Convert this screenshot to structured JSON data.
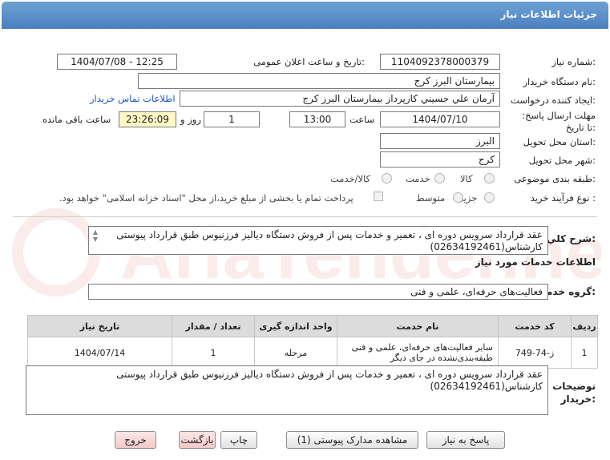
{
  "header": {
    "title": "جزئیات اطلاعات نیاز"
  },
  "form": {
    "need_number_label": "شماره نیاز:",
    "need_number": "1104092378000379",
    "announce_label": "تاریخ و ساعت اعلان عمومی:",
    "announce_value": "1404/07/08 - 12:25",
    "buyer_org_label": "نام دستگاه خریدار:",
    "buyer_org": "بیمارستان البرز کرج",
    "requester_label": "ایجاد کننده درخواست:",
    "requester": "آرمان علي حسيني كارپرداز بیمارستان البرز کرج",
    "contact_link": "اطلاعات تماس خریدار",
    "deadline_label": "مهلت ارسال پاسخ: تا تاریخ:",
    "deadline_date": "1404/07/10",
    "time_label": "ساعت",
    "deadline_time": "13:00",
    "days_value": "1",
    "days_label": "روز و",
    "remaining_time": "23:26:09",
    "remaining_label": "ساعت باقی مانده",
    "province_label": "استان محل تحویل:",
    "province": "البرز",
    "city_label": "شهر محل تحویل:",
    "city": "کرج",
    "category_label": "طبقه بندی موضوعی:",
    "category_options": [
      "کالا",
      "خدمت",
      "کالا/خدمت"
    ],
    "process_label": "نوع فرآیند خرید :",
    "process_options": [
      "جزیی",
      "متوسط"
    ],
    "payment_note": "پرداخت تمام یا بخشی از مبلغ خرید،از محل \"اسناد خزانه اسلامی\" خواهد بود."
  },
  "summary": {
    "label": "شرح کلي نياز:",
    "text": "عقد قرارداد سرویس دوره ای ، تعمیر و خدمات پس از فروش دستگاه دیالیز فرزنیوس طبق قرارداد پیوستی کارشناس(02634192461)"
  },
  "services_section": {
    "title": "اطلاعات خدمات مورد نیاز"
  },
  "service_group": {
    "label": "گروه خدمت:",
    "value": "فعالیت‌های حرفه‌ای، علمی و فنی"
  },
  "table": {
    "headers": [
      "ردیف",
      "کد خدمت",
      "نام خدمت",
      "واحد اندازه گیری",
      "تعداد / مقدار",
      "تاریخ نیاز"
    ],
    "rows": [
      [
        "1",
        "ز-74-749",
        "سایر فعالیت‌های حرفه‌ای، علمی و فنی طبقه‌بندی‌نشده در جای دیگر",
        "مرحله",
        "1",
        "1404/07/14"
      ]
    ]
  },
  "buyer_notes": {
    "label": "توضیحات خریدار:",
    "text": "عقد قرارداد سرویس دوره ای ، تعمیر و خدمات پس از فروش دستگاه دیالیز فرزنیوس طبق قرارداد پیوستی کارشناس(02634192461)"
  },
  "buttons": {
    "reply": "پاسخ به نیاز",
    "attachments": "مشاهده مدارک پیوستی (1)",
    "print": "چاپ",
    "back": "بازگشت",
    "exit": "خروج"
  },
  "watermark": {
    "text": "AriaTender.net"
  },
  "colors": {
    "header_bg": "#4a7fbf",
    "link": "#1a56c4",
    "highlight": "#fff8c6"
  }
}
